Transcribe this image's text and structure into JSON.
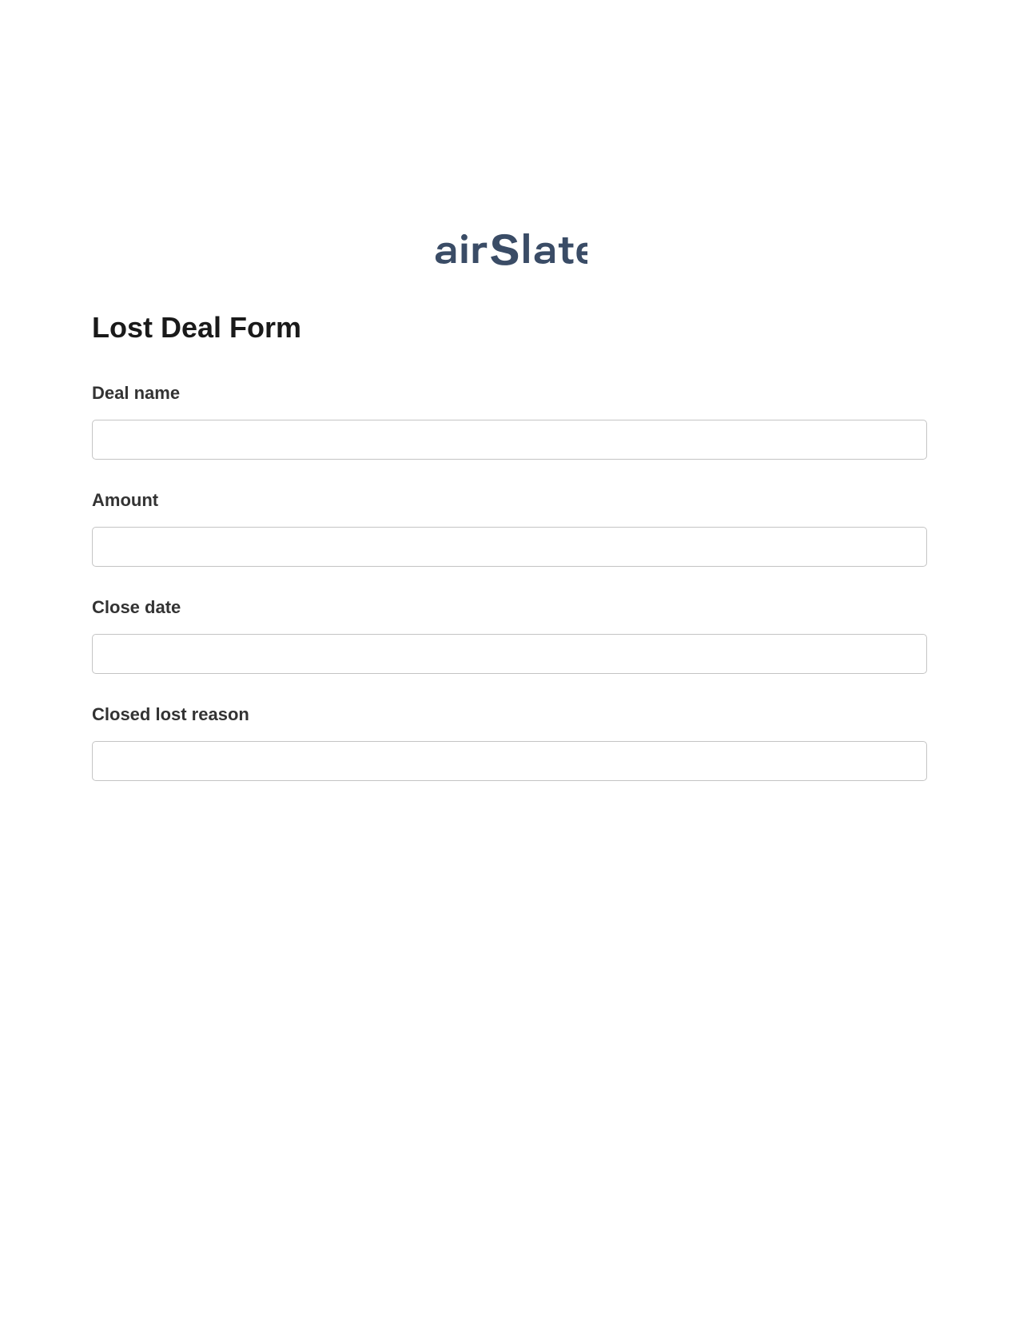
{
  "brand": {
    "name": "airSlate",
    "color": "#3a4c66"
  },
  "form": {
    "title": "Lost Deal Form",
    "fields": [
      {
        "label": "Deal name",
        "value": ""
      },
      {
        "label": "Amount",
        "value": ""
      },
      {
        "label": "Close date",
        "value": ""
      },
      {
        "label": "Closed lost reason",
        "value": ""
      }
    ]
  }
}
